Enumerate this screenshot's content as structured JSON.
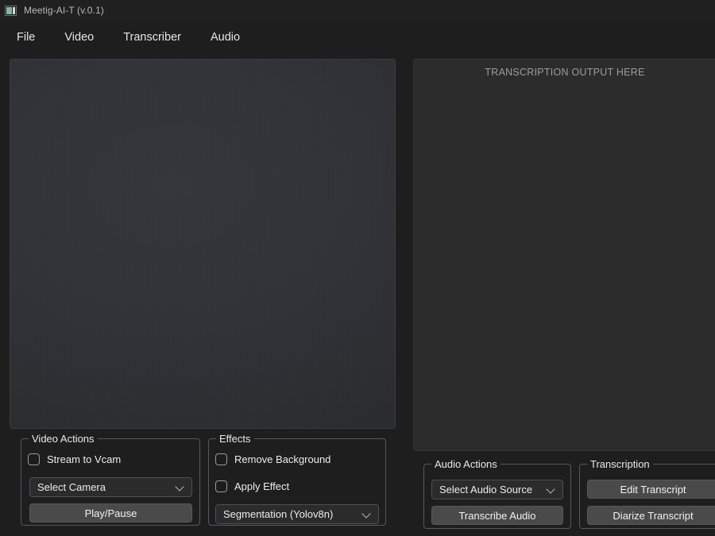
{
  "window": {
    "title": "Meetig-AI-T (v.0.1)",
    "icon": "app-window-icon"
  },
  "menubar": {
    "items": [
      {
        "label": "File",
        "name": "menu-file"
      },
      {
        "label": "Video",
        "name": "menu-video"
      },
      {
        "label": "Transcriber",
        "name": "menu-transcriber"
      },
      {
        "label": "Audio",
        "name": "menu-audio"
      }
    ]
  },
  "video_preview": {
    "name": "video-preview-area",
    "content": ""
  },
  "transcript_output": {
    "placeholder": "TRANSCRIPTION OUTPUT HERE"
  },
  "video_actions": {
    "title": "Video Actions",
    "stream_to_vcam": {
      "label": "Stream to Vcam",
      "checked": false
    },
    "camera_select": {
      "value": "Select Camera",
      "icon": "chevron-down-icon"
    },
    "play_pause": {
      "label": "Play/Pause"
    }
  },
  "effects": {
    "title": "Effects",
    "remove_background": {
      "label": "Remove Background",
      "checked": false
    },
    "apply_effect": {
      "label": "Apply Effect",
      "checked": false
    },
    "effect_select": {
      "value": "Segmentation (Yolov8n)",
      "icon": "chevron-down-icon"
    }
  },
  "audio_actions": {
    "title": "Audio Actions",
    "audio_source_select": {
      "value": "Select Audio Source",
      "icon": "chevron-down-icon"
    },
    "transcribe_audio": {
      "label": "Transcribe Audio"
    }
  },
  "transcription": {
    "title": "Transcription",
    "edit_transcript": {
      "label": "Edit Transcript"
    },
    "diarize_transcript": {
      "label": "Diarize Transcript"
    }
  },
  "colors": {
    "window_bg": "#1e1e1e",
    "titlebar_bg": "#202020",
    "panel_bg": "#2c2c2c",
    "button_bg": "#4a4a4a",
    "groupbox_border": "#56585c",
    "text_primary": "#ececec",
    "text_muted": "#9d9d9d",
    "icon_accent": "#7fb7ae"
  }
}
